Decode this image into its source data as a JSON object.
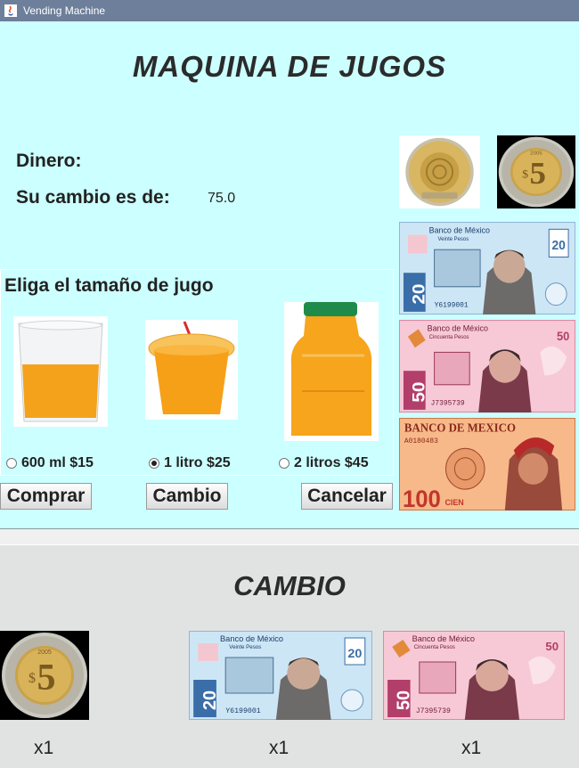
{
  "window": {
    "title": "Vending Machine",
    "icon": "java-app-icon"
  },
  "header": {
    "title": "MAQUINA DE JUGOS"
  },
  "money_display": {
    "dinero_label": "Dinero:",
    "dinero_value": "",
    "cambio_label": "Su cambio es de:",
    "cambio_value": "75.0"
  },
  "juice": {
    "title": "Eliga el tamaño de jugo",
    "options": [
      {
        "label": "600 ml  $15",
        "selected": false
      },
      {
        "label": "1 litro $25",
        "selected": true
      },
      {
        "label": "2 litros $45",
        "selected": false
      }
    ]
  },
  "buttons": {
    "comprar": "Comprar",
    "cambio": "Cambio",
    "cancelar": "Cancelar"
  },
  "cash_inputs": {
    "coin_10": "moneda 10 pesos",
    "coin_5": "moneda 5 pesos",
    "bill_20": {
      "bank": "Banco de México",
      "denom": "Veinte Pesos",
      "serial": "Y6199001",
      "number": "20"
    },
    "bill_50": {
      "bank": "Banco de México",
      "denom": "Cincuenta Pesos",
      "serial": "J7395739",
      "number": "50"
    },
    "bill_100": {
      "bank": "BANCO DE MEXICO",
      "serial": "A0180483",
      "number": "100",
      "word": "CIEN"
    }
  },
  "change": {
    "title": "CAMBIO",
    "items": [
      {
        "kind": "coin_5",
        "count": "x1"
      },
      {
        "kind": "bill_20",
        "count": "x1"
      },
      {
        "kind": "bill_50",
        "count": "x1"
      }
    ]
  },
  "colors": {
    "panel": "#ccffff",
    "bottom": "#e1e3e3",
    "titlebar": "#6d7f9a"
  }
}
